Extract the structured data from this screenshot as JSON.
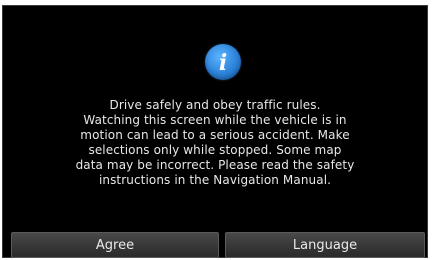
{
  "dialog": {
    "icon": "info-icon",
    "icon_glyph": "i",
    "message": "Drive safely and obey traffic rules.\nWatching this screen while the vehicle is in\nmotion can lead to a serious accident. Make\nselections only while stopped. Some map\ndata may be incorrect. Please read the safety\ninstructions in the Navigation Manual."
  },
  "buttons": {
    "agree_label": "Agree",
    "language_label": "Language"
  },
  "colors": {
    "background": "#000000",
    "text": "#e7e7e7",
    "icon_blue": "#2c82d9"
  }
}
